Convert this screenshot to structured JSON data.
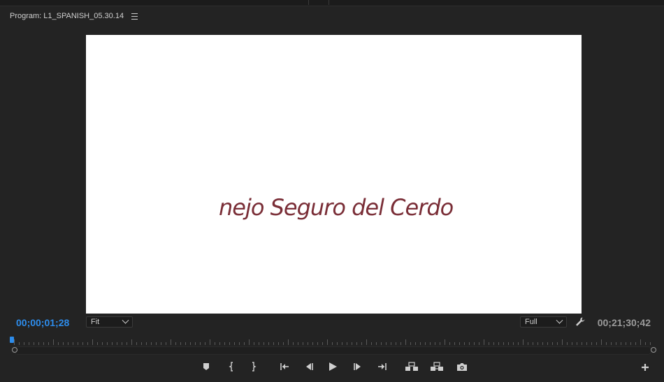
{
  "panel": {
    "title": "Program: L1_SPANISH_05.30.14",
    "menu_icon": "hamburger-icon"
  },
  "viewer": {
    "frame_text": "nejo Seguro del Cerdo",
    "frame_text_color": "#7a2e37",
    "background": "#ffffff"
  },
  "playback": {
    "current_time": "00;00;01;28",
    "current_time_color": "#2d8ceb",
    "duration": "00;21;30;42",
    "zoom_level": "Fit",
    "resolution": "Full",
    "settings_icon": "wrench-icon"
  },
  "transport": {
    "controls": [
      "add-marker-icon",
      "mark-in-icon",
      "mark-out-icon",
      "go-to-in-icon",
      "step-back-icon",
      "play-icon",
      "step-forward-icon",
      "go-to-out-icon",
      "lift-icon",
      "extract-icon",
      "export-frame-icon"
    ],
    "add_button_icon": "plus-icon"
  },
  "colors": {
    "panel_bg": "#232323",
    "accent": "#2d8ceb",
    "icon": "#cfcfcf"
  }
}
